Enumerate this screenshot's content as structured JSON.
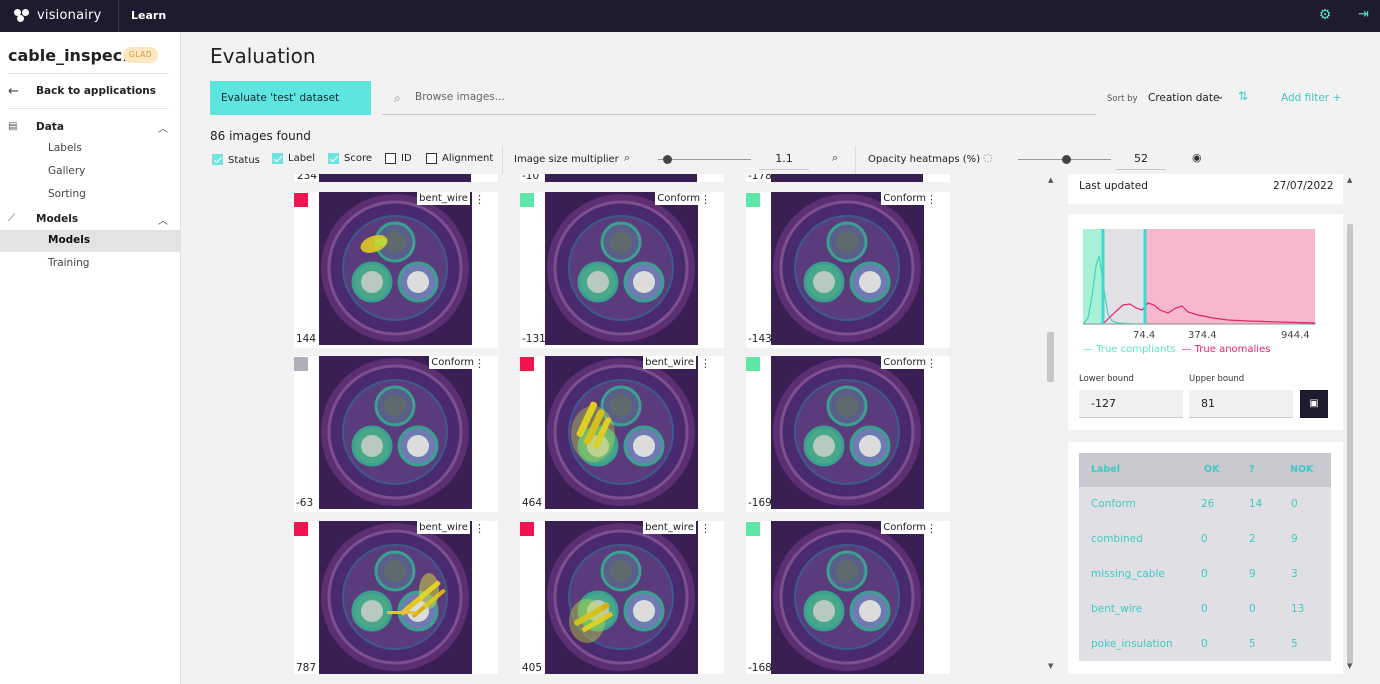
{
  "topbar": {
    "brand": "visionairy",
    "section": "Learn",
    "settings_icon": "gear-icon",
    "logout_icon": "logout-icon"
  },
  "sidebar": {
    "app_title": "cable_inspec...",
    "badge": "GLAD",
    "back_label": "Back to applications",
    "sections": [
      {
        "label": "Data",
        "icon": "database-icon",
        "items": [
          "Labels",
          "Gallery",
          "Sorting"
        ]
      },
      {
        "label": "Models",
        "icon": "chart-icon",
        "items": [
          "Models",
          "Training"
        ]
      }
    ],
    "active_item": "Models"
  },
  "main": {
    "title": "Evaluation",
    "evaluate_button": "Evaluate 'test' dataset",
    "search_placeholder": "Browse images...",
    "sort_by_label": "Sort by",
    "sort_value": "Creation date",
    "add_filter": "Add filter",
    "images_found": "86 images found"
  },
  "toolbar": {
    "checkboxes": [
      {
        "label": "Status",
        "checked": true
      },
      {
        "label": "Label",
        "checked": true
      },
      {
        "label": "Score",
        "checked": true
      },
      {
        "label": "ID",
        "checked": false
      },
      {
        "label": "Alignment",
        "checked": false
      }
    ],
    "image_size_label": "Image size multiplier",
    "image_size_value": "1.1",
    "opacity_label": "Opacity heatmaps (%)",
    "opacity_value": "52"
  },
  "gallery": {
    "top_partial_scores": [
      "234",
      "-10",
      "-178"
    ],
    "rows": [
      [
        {
          "status_color": "#f0144f",
          "label": "bent_wire",
          "score": "144",
          "heat": "small-yellow"
        },
        {
          "status_color": "#5de6a6",
          "label": "Conform",
          "score": "-131",
          "heat": "none"
        },
        {
          "status_color": "#5de6a6",
          "label": "Conform",
          "score": "-143",
          "heat": "none"
        }
      ],
      [
        {
          "status_color": "#b0aeb8",
          "label": "Conform",
          "score": "-63",
          "heat": "none"
        },
        {
          "status_color": "#f0144f",
          "label": "bent_wire",
          "score": "464",
          "heat": "large-yellow"
        },
        {
          "status_color": "#5de6a6",
          "label": "Conform",
          "score": "-169",
          "heat": "none"
        }
      ],
      [
        {
          "status_color": "#f0144f",
          "label": "bent_wire",
          "score": "787",
          "heat": "diagonal-yellow"
        },
        {
          "status_color": "#f0144f",
          "label": "bent_wire",
          "score": "405",
          "heat": "lower-yellow"
        },
        {
          "status_color": "#5de6a6",
          "label": "Conform",
          "score": "-168",
          "heat": "none"
        }
      ]
    ]
  },
  "panel": {
    "last_updated_label": "Last updated",
    "last_updated_value": "27/07/2022",
    "histogram": {
      "tick_labels": [
        "74.4",
        "374.4",
        "944.4"
      ],
      "legend_compliant": "True compliants",
      "legend_anomalies": "True anomalies",
      "colors": {
        "compliant": "#5de6c4",
        "anomaly": "#e5226d",
        "ok_zone": "#a8f0d8",
        "unsure_zone": "#e2e2e6",
        "nok_zone": "#f7b8cd"
      }
    },
    "lower_bound_label": "Lower bound",
    "lower_bound_value": "-127",
    "upper_bound_label": "Upper bound",
    "upper_bound_value": "81",
    "table": {
      "headers": [
        "Label",
        "OK",
        "?",
        "NOK"
      ],
      "rows": [
        [
          "Conform",
          "26",
          "14",
          "0"
        ],
        [
          "combined",
          "0",
          "2",
          "9"
        ],
        [
          "missing_cable",
          "0",
          "9",
          "3"
        ],
        [
          "bent_wire",
          "0",
          "0",
          "13"
        ],
        [
          "poke_insulation",
          "0",
          "5",
          "5"
        ]
      ]
    }
  }
}
